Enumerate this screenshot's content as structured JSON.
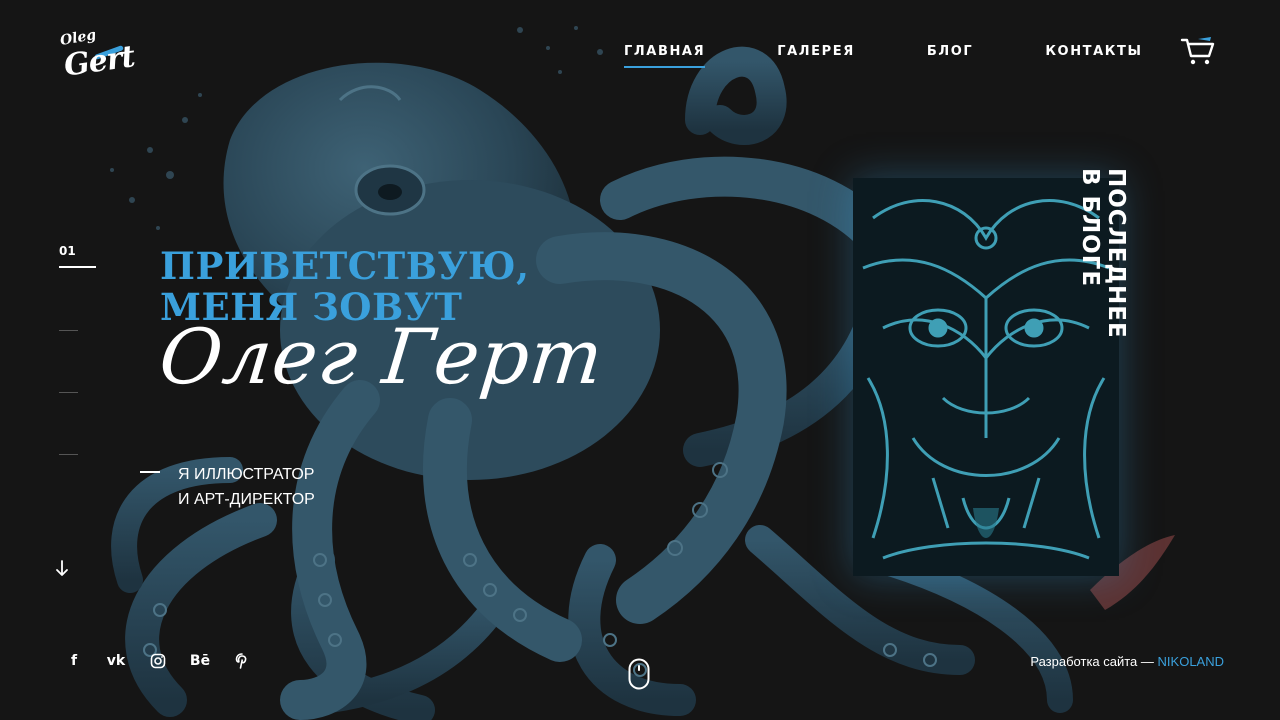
{
  "logo": {
    "top": "Oleg",
    "main": "Gert"
  },
  "nav": {
    "items": [
      {
        "label": "ГЛАВНАЯ",
        "active": true
      },
      {
        "label": "ГАЛЕРЕЯ",
        "active": false
      },
      {
        "label": "БЛОГ",
        "active": false
      },
      {
        "label": "КОНТАКТЫ",
        "active": false
      }
    ],
    "cart_icon": "cart-icon"
  },
  "slider": {
    "current": "01",
    "total_dashes": 3
  },
  "hero": {
    "greeting_line1": "ПРИВЕТСТВУЮ,",
    "greeting_line2": "МЕНЯ ЗОВУТ",
    "name": "Олег Герт",
    "subtitle_line1": "Я ИЛЛЮСТРАТОР",
    "subtitle_line2": "И АРТ-ДИРЕКТОР"
  },
  "blog": {
    "label_line1": "ПОСЛЕДНЕЕ",
    "label_line2": "В БЛОГЕ"
  },
  "social": [
    {
      "name": "facebook-icon",
      "glyph": "f"
    },
    {
      "name": "vk-icon",
      "glyph": "vk"
    },
    {
      "name": "instagram-icon",
      "glyph": ""
    },
    {
      "name": "behance-icon",
      "glyph": "Bē"
    },
    {
      "name": "pinterest-icon",
      "glyph": ""
    }
  ],
  "footer": {
    "credit_text": "Разработка сайта —",
    "credit_link": "NIKOLAND"
  },
  "colors": {
    "accent": "#3aa0dc",
    "background": "#151515",
    "octopus": "#2c4b5e"
  }
}
